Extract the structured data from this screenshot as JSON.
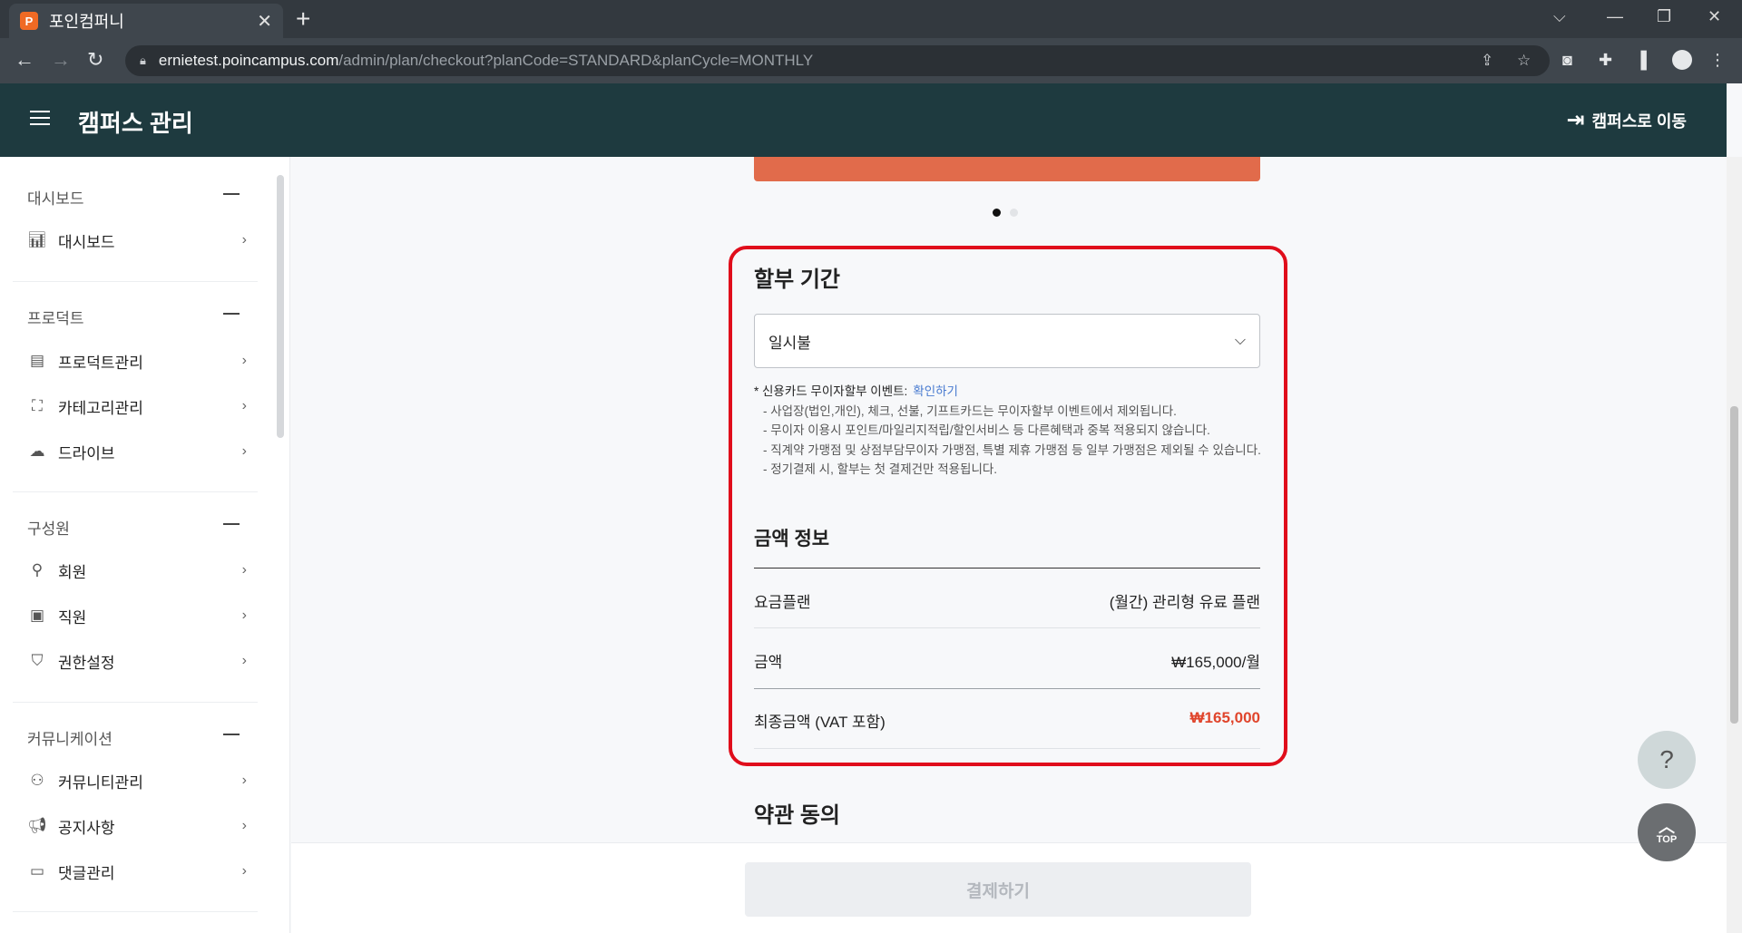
{
  "browser": {
    "tab_title": "포인컴퍼니",
    "tab_favicon": "P",
    "tab_close": "✕",
    "new_tab": "+",
    "url_host": "ernietest.poincampus.com",
    "url_path": "/admin/plan/checkout?planCode=STANDARD&planCycle=MONTHLY"
  },
  "header": {
    "title": "캠퍼스 관리",
    "goto_campus": "캠퍼스로 이동"
  },
  "sidebar": {
    "sections": [
      {
        "title": "대시보드",
        "items": [
          {
            "label": "대시보드",
            "icon": "bar-chart-icon"
          }
        ]
      },
      {
        "title": "프로덕트",
        "items": [
          {
            "label": "프로덕트관리",
            "icon": "folder-icon"
          },
          {
            "label": "카테고리관리",
            "icon": "category-icon"
          },
          {
            "label": "드라이브",
            "icon": "cloud-icon"
          }
        ]
      },
      {
        "title": "구성원",
        "items": [
          {
            "label": "회원",
            "icon": "member-icon"
          },
          {
            "label": "직원",
            "icon": "staff-badge-icon"
          },
          {
            "label": "권한설정",
            "icon": "shield-icon"
          }
        ]
      },
      {
        "title": "커뮤니케이션",
        "items": [
          {
            "label": "커뮤니티관리",
            "icon": "community-icon"
          },
          {
            "label": "공지사항",
            "icon": "megaphone-icon"
          },
          {
            "label": "댓글관리",
            "icon": "comment-icon"
          }
        ]
      }
    ]
  },
  "installment": {
    "title": "할부 기간",
    "selected": "일시불",
    "notice_head": "* 신용카드 무이자할부 이벤트:",
    "notice_link": "확인하기",
    "notice_lines": [
      "- 사업장(법인,개인), 체크, 선불, 기프트카드는 무이자할부 이벤트에서 제외됩니다.",
      "- 무이자 이용시 포인트/마일리지적립/할인서비스 등 다른혜택과 중복 적용되지 않습니다.",
      "- 직계약 가맹점 및 상점부담무이자 가맹점, 특별 제휴 가맹점 등 일부 가맹점은 제외될 수 있습니다.",
      "- 정기결제 시, 할부는 첫 결제건만 적용됩니다."
    ]
  },
  "price": {
    "title": "금액 정보",
    "rows": [
      {
        "label": "요금플랜",
        "value": "(월간) 관리형 유료 플랜"
      },
      {
        "label": "금액",
        "value": "₩165,000/월"
      },
      {
        "label": "최종금액 (VAT 포함)",
        "value": "₩165,000"
      }
    ]
  },
  "terms": {
    "title": "약관 동의"
  },
  "pay_button": "결제하기",
  "fab": {
    "help": "?",
    "top": "TOP"
  },
  "colors": {
    "header_bg": "#1e3a3f",
    "accent_red": "#e0452c",
    "highlight": "#e00d1b"
  }
}
